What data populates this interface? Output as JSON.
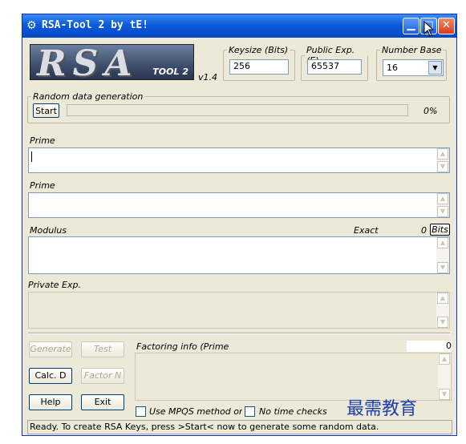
{
  "window": {
    "title": "RSA-Tool 2 by tE!"
  },
  "logo": {
    "main": "RSA",
    "sub": "TOOL 2",
    "version": "v1.4"
  },
  "keysize": {
    "legend": "Keysize (Bits)",
    "value": "256"
  },
  "public_exp": {
    "legend": "Public Exp. (E)",
    "value": "65537"
  },
  "number_base": {
    "legend": "Number Base",
    "value": "16"
  },
  "random": {
    "legend": "Random data generation",
    "start_label": "Start",
    "progress_text": "0%",
    "progress": 0
  },
  "prime1": {
    "label": "Prime",
    "value": ""
  },
  "prime2": {
    "label": "Prime",
    "value": ""
  },
  "modulus": {
    "label": "Modulus",
    "exact_label": "Exact",
    "bits_value": "0",
    "bits_button": "Bits"
  },
  "private_exp": {
    "label": "Private Exp."
  },
  "buttons": {
    "generate": "Generate",
    "test": "Test",
    "calc_d": "Calc. D",
    "factor_n": "Factor N",
    "help": "Help",
    "exit": "Exit"
  },
  "factoring": {
    "label": "Factoring info (Prime",
    "count": "0"
  },
  "options": {
    "mpqs": "Use MPQS method only",
    "no_time": "No time checks"
  },
  "status": "Ready. To create RSA Keys, press >Start< now to generate some random data.",
  "watermark": "最需教育",
  "colors": {
    "titlebar": "#0a5bd9",
    "window_bg": "#ece9d8",
    "close_button": "#d63c1a"
  }
}
